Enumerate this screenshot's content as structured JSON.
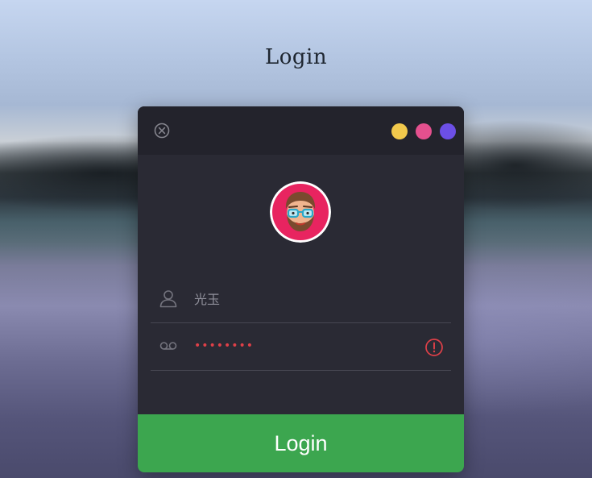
{
  "page": {
    "title": "Login"
  },
  "window": {
    "dots": [
      {
        "name": "yellow",
        "color": "#f2c94c"
      },
      {
        "name": "pink",
        "color": "#e4508e"
      },
      {
        "name": "purple",
        "color": "#6c4fe6"
      }
    ]
  },
  "form": {
    "username_value": "光玉",
    "password_value": "••••••••",
    "login_label": "Login"
  },
  "icons": {
    "close": "close-circle-icon",
    "user": "user-icon",
    "password": "voicemail-icon",
    "warning": "exclamation-circle-icon",
    "avatar": "bearded-man-glasses-avatar"
  },
  "colors": {
    "login_button": "#3ca64f",
    "error": "#e04048",
    "card": "#2a2a34",
    "titlebar": "#23232c",
    "avatar_ring": "#e82460"
  }
}
